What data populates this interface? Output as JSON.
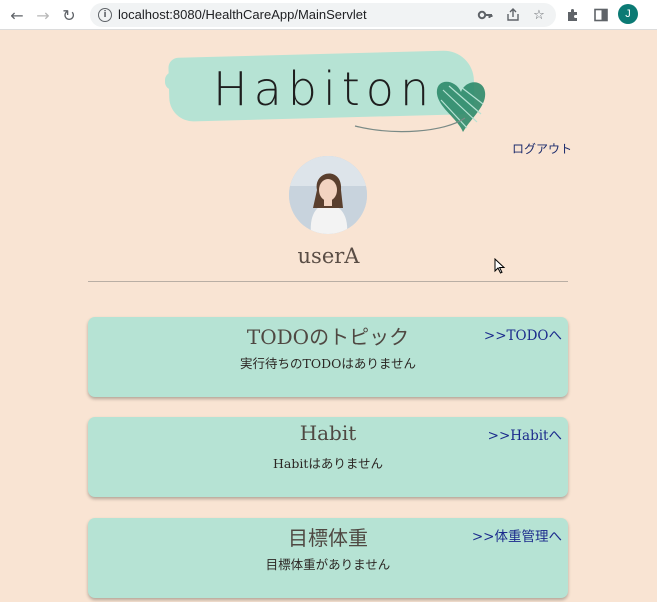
{
  "browser": {
    "url": "localhost:8080/HealthCareApp/MainServlet",
    "profile_initial": "J",
    "icons": [
      "back-arrow-icon",
      "forward-arrow-icon",
      "reload-icon",
      "info-icon",
      "key-icon",
      "share-icon",
      "star-icon",
      "extensions-icon",
      "side-panel-icon"
    ]
  },
  "header": {
    "logo_text": "Habiton",
    "logout_label": "ログアウト"
  },
  "user": {
    "name": "userA"
  },
  "cards": [
    {
      "title": "TODOのトピック",
      "link": ">>TODOへ",
      "message": "実行待ちのTODOはありません"
    },
    {
      "title": "Habit",
      "link": ">>Habitへ",
      "message": "Habitはありません"
    },
    {
      "title": "目標体重",
      "link": ">>体重管理へ",
      "message": "目標体重がありません"
    }
  ],
  "colors": {
    "background": "#f9e4d3",
    "card": "#b6e3d4",
    "link": "#1b2a8c",
    "logo_brush": "#b6e3d4",
    "profile": "#0b7a74"
  }
}
